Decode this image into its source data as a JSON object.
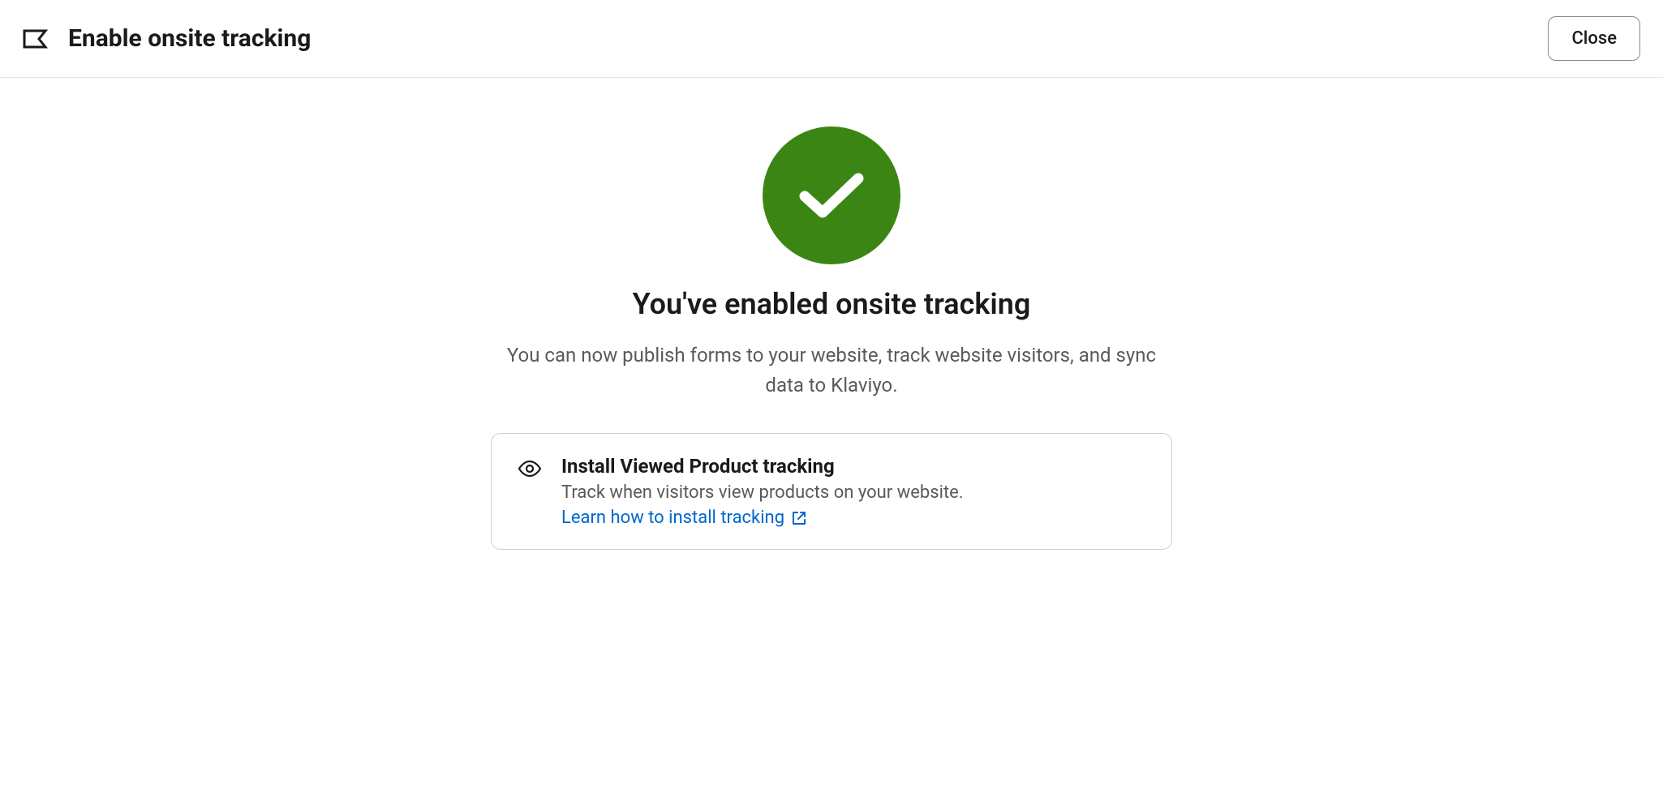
{
  "header": {
    "title": "Enable onsite tracking",
    "close_label": "Close"
  },
  "main": {
    "heading": "You've enabled onsite tracking",
    "description": "You can now publish forms to your website, track website visitors, and sync data to Klaviyo."
  },
  "card": {
    "title": "Install Viewed Product tracking",
    "description": "Track when visitors view products on your website.",
    "link_label": "Learn how to install tracking"
  }
}
